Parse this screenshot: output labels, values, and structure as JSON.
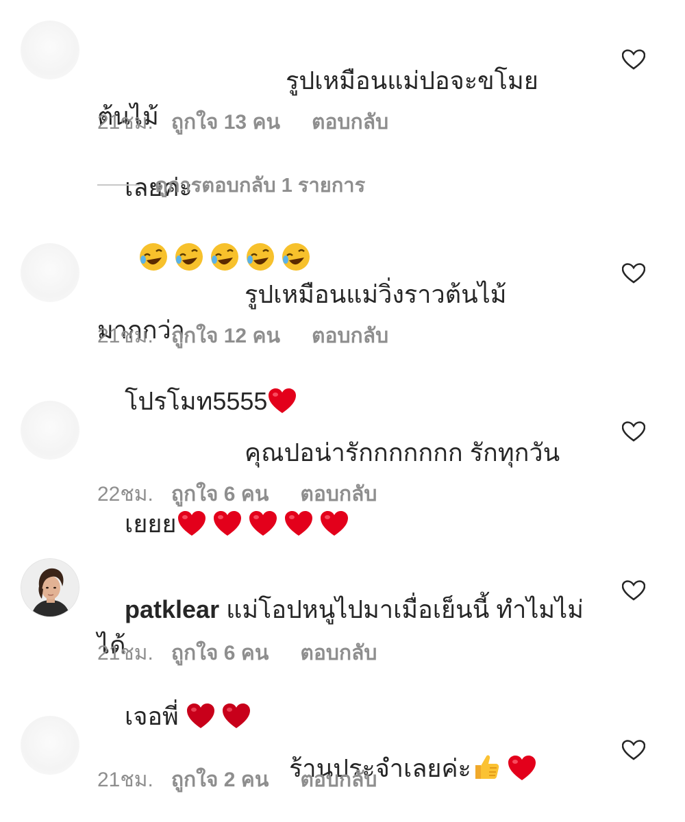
{
  "comments": [
    {
      "username": "",
      "text_line1": "รูปเหมือนแม่ปอจะขโมยต้นไม้",
      "text_line2": "เลยค่ะ",
      "emojis": "🤣🤣🤣🤣🤣",
      "time": "21ชม.",
      "likes": "ถูกใจ 13 คน",
      "reply": "ตอบกลับ"
    },
    {
      "username": "",
      "text_line1": "รูปเหมือนแม่วิ่งราวต้นไม้มากกว่า",
      "text_line2": "โปรโมท5555",
      "emojis": "❤️",
      "time": "21ชม.",
      "likes": "ถูกใจ 12 คน",
      "reply": "ตอบกลับ"
    },
    {
      "username": "",
      "text_line1": "คุณปอน่ารักกกกกกก รักทุกวัน",
      "text_line2": "เยยย",
      "emojis": "❤️❤️❤️❤️❤️",
      "time": "22ชม.",
      "likes": "ถูกใจ 6 คน",
      "reply": "ตอบกลับ"
    },
    {
      "username": "patklear",
      "text_line1": "แม่โอปหนูไปมาเมื่อเย็นนี้ ทำไมไม่ได้",
      "text_line2": "เจอพี่",
      "emojis": "❤️❤️",
      "time": "21ชม.",
      "likes": "ถูกใจ 6 คน",
      "reply": "ตอบกลับ"
    },
    {
      "username": "",
      "text_line1": "ร้านประจำเลยค่ะ",
      "text_line2": "",
      "emojis": "👍❤️",
      "time": "21ชม.",
      "likes": "ถูกใจ 2 คน",
      "reply": "ตอบกลับ"
    }
  ],
  "view_replies": "ดูการตอบกลับ 1 รายการ",
  "icons": {
    "like": "heart-outline-icon",
    "laugh": "rolling-on-floor-laughing-emoji",
    "heart": "red-heart-emoji",
    "thumbs": "thumbs-up-emoji"
  },
  "colors": {
    "text": "#262626",
    "secondary": "#8e8e8e",
    "heart": "#e3001b"
  }
}
